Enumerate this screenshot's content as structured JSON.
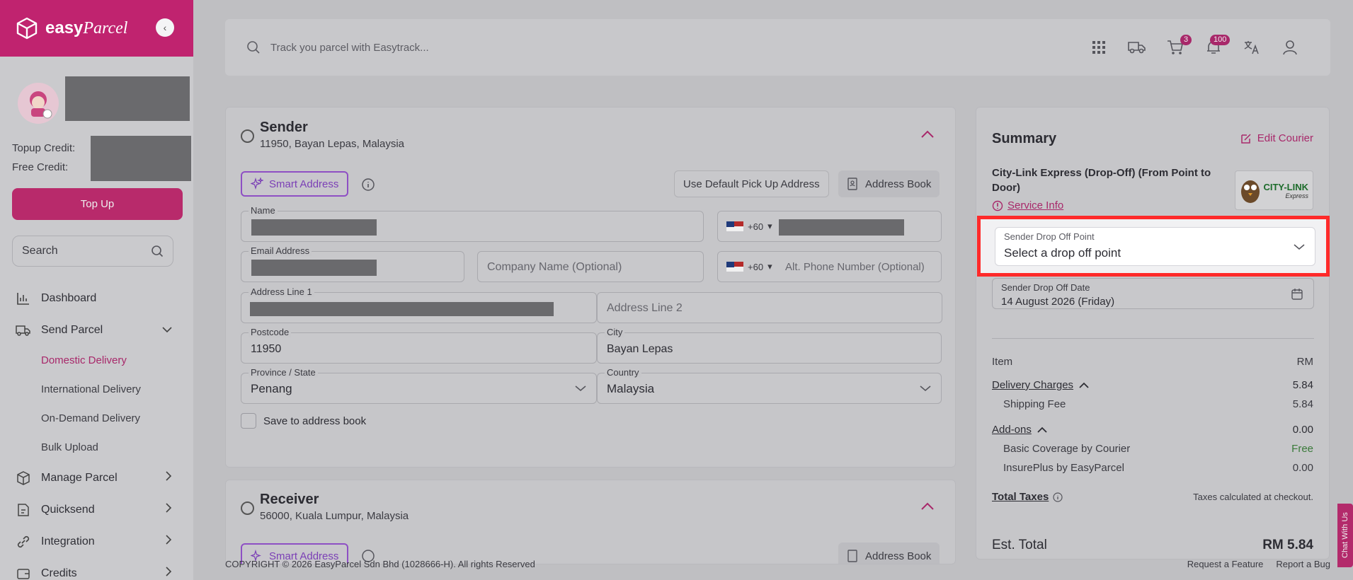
{
  "brand": {
    "name_bold": "easy",
    "name_italic": "Parcel"
  },
  "sidebar": {
    "topup_label": "Topup Credit:",
    "free_label": "Free Credit:",
    "topup_button": "Top Up",
    "search_placeholder": "Search",
    "items": [
      {
        "label": "Dashboard",
        "icon": "chart-icon"
      },
      {
        "label": "Send Parcel",
        "icon": "truck-icon"
      },
      {
        "label": "Domestic Delivery"
      },
      {
        "label": "International Delivery"
      },
      {
        "label": "On-Demand Delivery"
      },
      {
        "label": "Bulk Upload"
      },
      {
        "label": "Manage Parcel",
        "icon": "box-icon"
      },
      {
        "label": "Quicksend",
        "icon": "note-icon"
      },
      {
        "label": "Integration",
        "icon": "link-icon"
      },
      {
        "label": "Credits",
        "icon": "wallet-icon"
      }
    ]
  },
  "topbar": {
    "search_placeholder": "Track you parcel with Easytrack...",
    "cart_count": "3",
    "notif_count": "100"
  },
  "sender": {
    "title": "Sender",
    "subtitle": "11950, Bayan Lepas, Malaysia",
    "smart_address": "Smart Address",
    "use_default": "Use Default Pick Up Address",
    "address_book": "Address Book",
    "name_label": "Name",
    "phone_prefix": "+60",
    "email_label": "Email Address",
    "company_placeholder": "Company Name (Optional)",
    "alt_phone_placeholder": "Alt. Phone Number (Optional)",
    "addr1_label": "Address Line 1",
    "addr2_placeholder": "Address Line 2",
    "postcode_label": "Postcode",
    "postcode_value": "11950",
    "city_label": "City",
    "city_value": "Bayan Lepas",
    "state_label": "Province / State",
    "state_value": "Penang",
    "country_label": "Country",
    "country_value": "Malaysia",
    "save_label": "Save to address book"
  },
  "receiver": {
    "title": "Receiver",
    "subtitle": "56000, Kuala Lumpur, Malaysia",
    "smart_address": "Smart Address",
    "address_book": "Address Book"
  },
  "summary": {
    "title": "Summary",
    "edit_courier": "Edit Courier",
    "courier_name": "City-Link Express (Drop-Off) (From Point to Door)",
    "service_info": "Service Info",
    "courier_logo": "CITY-LINK",
    "courier_logo_sub": "Express",
    "dropoff_label": "Sender Drop Off Point",
    "dropoff_placeholder": "Select a drop off point",
    "date_label": "Sender Drop Off Date",
    "date_value": "14 August 2026 (Friday)",
    "item_label": "Item",
    "item_currency": "RM",
    "delivery_label": "Delivery Charges",
    "delivery_value": "5.84",
    "shipping_label": "Shipping Fee",
    "shipping_value": "5.84",
    "addons_label": "Add-ons",
    "addons_value": "0.00",
    "basic_label": "Basic Coverage by Courier",
    "basic_value": "Free",
    "insure_label": "InsurePlus by EasyParcel",
    "insure_value": "0.00",
    "taxes_label": "Total Taxes",
    "taxes_note": "Taxes calculated at checkout.",
    "total_label": "Est. Total",
    "total_value": "RM 5.84"
  },
  "footer": {
    "copyright": "COPYRIGHT © 2026 EasyParcel Sdn Bhd (1028666-H). All rights Reserved",
    "request": "Request a Feature",
    "bug": "Report a Bug"
  },
  "chat_tab": "Chat With Us"
}
